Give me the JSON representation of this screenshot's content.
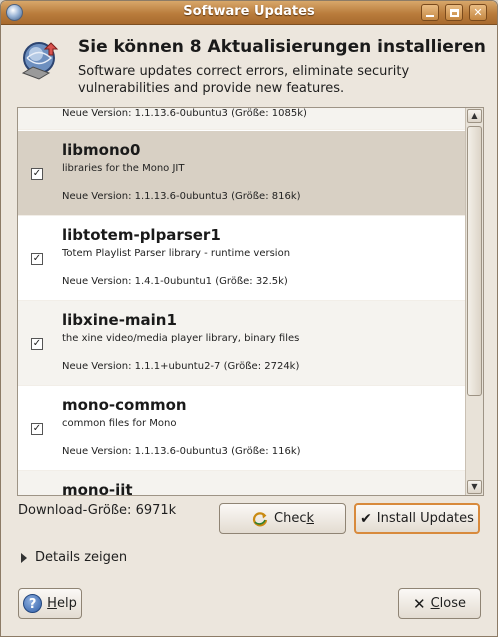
{
  "window": {
    "title": "Software Updates"
  },
  "header": {
    "title": "Sie können 8 Aktualisierungen installieren",
    "description": "Software updates correct errors, eliminate security vulnerabilities and provide new features."
  },
  "updates": [
    {
      "name": "",
      "description": "",
      "version": "Neue Version: 1.1.13.6-0ubuntu3 (Größe: 1085k)",
      "checked": true
    },
    {
      "name": "libmono0",
      "description": "libraries for the Mono JIT",
      "version": "Neue Version: 1.1.13.6-0ubuntu3 (Größe: 816k)",
      "checked": true
    },
    {
      "name": "libtotem-plparser1",
      "description": "Totem Playlist Parser library - runtime version",
      "version": "Neue Version: 1.4.1-0ubuntu1 (Größe: 32.5k)",
      "checked": true
    },
    {
      "name": "libxine-main1",
      "description": "the xine video/media player library, binary files",
      "version": "Neue Version: 1.1.1+ubuntu2-7 (Größe: 2724k)",
      "checked": true
    },
    {
      "name": "mono-common",
      "description": "common files for Mono",
      "version": "Neue Version: 1.1.13.6-0ubuntu3 (Größe: 116k)",
      "checked": true
    },
    {
      "name": "mono-jit",
      "description": "",
      "version": "",
      "checked": true
    }
  ],
  "download_size": "Download-Größe: 6971k",
  "buttons": {
    "check_pre": "Chec",
    "check_mnemonic": "k",
    "install": "Install Updates",
    "help_mnemonic": "H",
    "help_rest": "elp",
    "close_mnemonic": "C",
    "close_rest": "lose"
  },
  "details_label": "Details zeigen",
  "checkbox_glyph": "✓"
}
